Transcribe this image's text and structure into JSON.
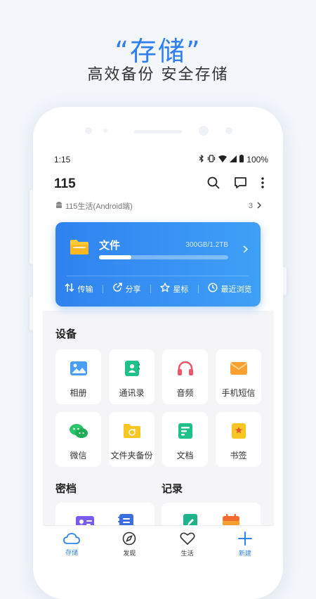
{
  "promo": {
    "headline": "“存储”",
    "subline": "高效备份 安全存储"
  },
  "status_bar": {
    "time": "1:15",
    "battery": "100%"
  },
  "app_bar": {
    "title": "115"
  },
  "device_row": {
    "label": "115生活(Android端)",
    "count": "3"
  },
  "file_card": {
    "title": "文件",
    "storage": "300GB/1.2TB",
    "usage_fraction": 0.25,
    "actions": [
      {
        "label": "传输",
        "icon": "transfer-icon"
      },
      {
        "label": "分享",
        "icon": "share-icon"
      },
      {
        "label": "星标",
        "icon": "star-icon"
      },
      {
        "label": "最近浏览",
        "icon": "clock-icon"
      }
    ]
  },
  "devices": {
    "title": "设备",
    "items": [
      {
        "label": "相册",
        "icon": "album-icon",
        "color": "#4a9ff5"
      },
      {
        "label": "通讯录",
        "icon": "contacts-icon",
        "color": "#1fc08a"
      },
      {
        "label": "音频",
        "icon": "headphones-icon",
        "color": "#f2566b"
      },
      {
        "label": "手机短信",
        "icon": "message-icon",
        "color": "#f7a02f"
      },
      {
        "label": "微信",
        "icon": "wechat-icon",
        "color": "#2bc46a"
      },
      {
        "label": "文件夹备份",
        "icon": "folder-backup-icon",
        "color": "#f7c623"
      },
      {
        "label": "文档",
        "icon": "document-icon",
        "color": "#1fc08a"
      },
      {
        "label": "书签",
        "icon": "bookmark-icon",
        "color": "#f7c623"
      }
    ]
  },
  "vault": {
    "title": "密档"
  },
  "records": {
    "title": "记录"
  },
  "tabs": [
    {
      "label": "存储",
      "icon": "cloud-icon",
      "active": true
    },
    {
      "label": "发现",
      "icon": "compass-icon",
      "active": false
    },
    {
      "label": "生活",
      "icon": "heart-icon",
      "active": false
    },
    {
      "label": "新建",
      "icon": "plus-icon",
      "active": false
    }
  ],
  "colors": {
    "accent": "#2f82ef",
    "headline": "#2f7ff0"
  }
}
